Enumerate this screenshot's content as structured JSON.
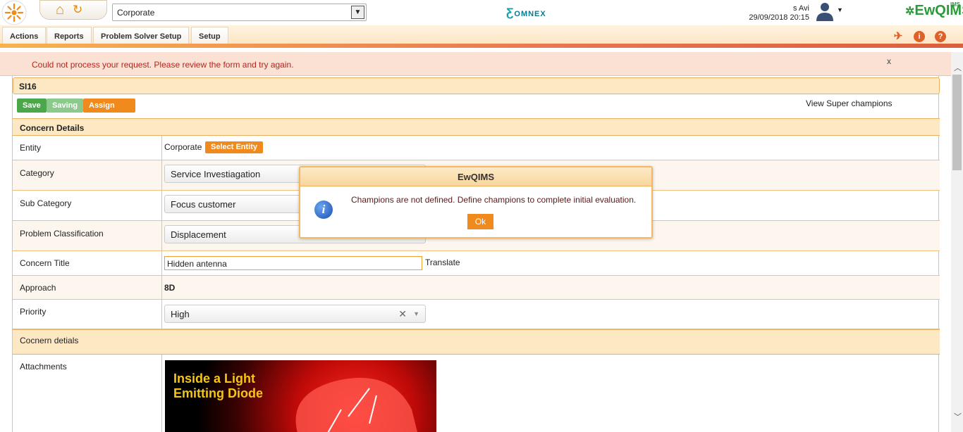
{
  "header": {
    "entity_select_value": "Corporate",
    "brand_omnex": "OMNEX",
    "user_name": "s Avi",
    "datetime": "29/09/2018 20:15",
    "ewqims_logo": "EwQIMS",
    "ims_badge": "IMS"
  },
  "menu": {
    "tabs": [
      {
        "label": "Actions"
      },
      {
        "label": "Reports"
      },
      {
        "label": "Problem Solver Setup"
      },
      {
        "label": "Setup"
      }
    ]
  },
  "error_banner": {
    "message": "Could not process your request. Please review the form and try again.",
    "close": "x"
  },
  "record": {
    "id_title": "SI16",
    "buttons": {
      "save": "Save",
      "saving": "Saving",
      "assign": "Assign champions"
    },
    "view_super": "View Super champions"
  },
  "concern": {
    "section_title": "Concern Details",
    "entity_label": "Entity",
    "entity_value": "Corporate",
    "select_entity_button": "Select Entity",
    "category_label": "Category",
    "category_value": "Service Investiagation",
    "subcategory_label": "Sub Category",
    "subcategory_value": "Focus customer",
    "classification_label": "Problem Classification",
    "classification_value": "Displacement",
    "title_label": "Concern Title",
    "title_value": "Hidden antenna",
    "translate_link": "Translate",
    "approach_label": "Approach",
    "approach_value": "8D",
    "priority_label": "Priority",
    "priority_value": "High",
    "details_section": "Cocnern detials",
    "attachments_label": "Attachments",
    "attachment_image_text": "Inside a Light Emitting Diode"
  },
  "modal": {
    "title": "EwQIMS",
    "message": "Champions are not defined. Define champions to complete initial evaluation.",
    "ok": "Ok"
  },
  "colors": {
    "accent_orange": "#f18a1c",
    "save_green": "#4aa84a",
    "error_text": "#b3261e"
  }
}
